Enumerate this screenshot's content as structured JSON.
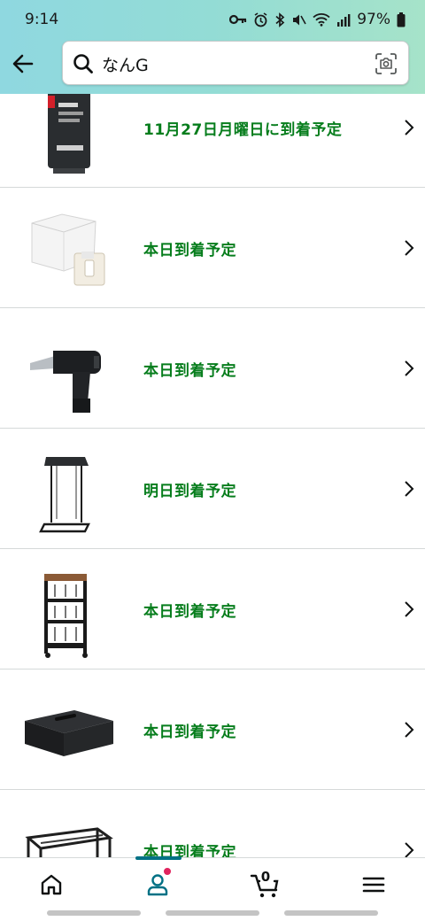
{
  "status_bar": {
    "time": "9:14",
    "battery": "97%",
    "icons": [
      "key-icon",
      "alarm-icon",
      "bluetooth-icon",
      "mute-icon",
      "wifi-icon",
      "signal-icon",
      "battery-icon"
    ]
  },
  "header": {
    "back_icon": "back-arrow-icon",
    "search": {
      "icon": "search-icon",
      "value": "なんG",
      "camera_icon": "camera-icon"
    }
  },
  "results": [
    {
      "delivery": "11月27日月曜日に到着予定",
      "image": "usb-ssd-stick"
    },
    {
      "delivery": "本日到着予定",
      "image": "smart-switch-bot"
    },
    {
      "delivery": "本日到着予定",
      "image": "electric-air-duster"
    },
    {
      "delivery": "明日到着予定",
      "image": "side-table"
    },
    {
      "delivery": "本日到着予定",
      "image": "slim-rolling-cart"
    },
    {
      "delivery": "本日到着予定",
      "image": "tissue-box-case"
    },
    {
      "delivery": "本日到着予定",
      "image": "metal-rack"
    }
  ],
  "bottom_nav": {
    "items": [
      "home-icon",
      "account-icon",
      "cart-icon",
      "menu-icon"
    ],
    "cart_count": "0",
    "active": "account"
  },
  "colors": {
    "delivery_green": "#067d1c",
    "header_gradient_start": "#8fd8e0",
    "header_gradient_end": "#a6e3c9",
    "active_indicator": "#007185",
    "badge": "#e0245e"
  }
}
